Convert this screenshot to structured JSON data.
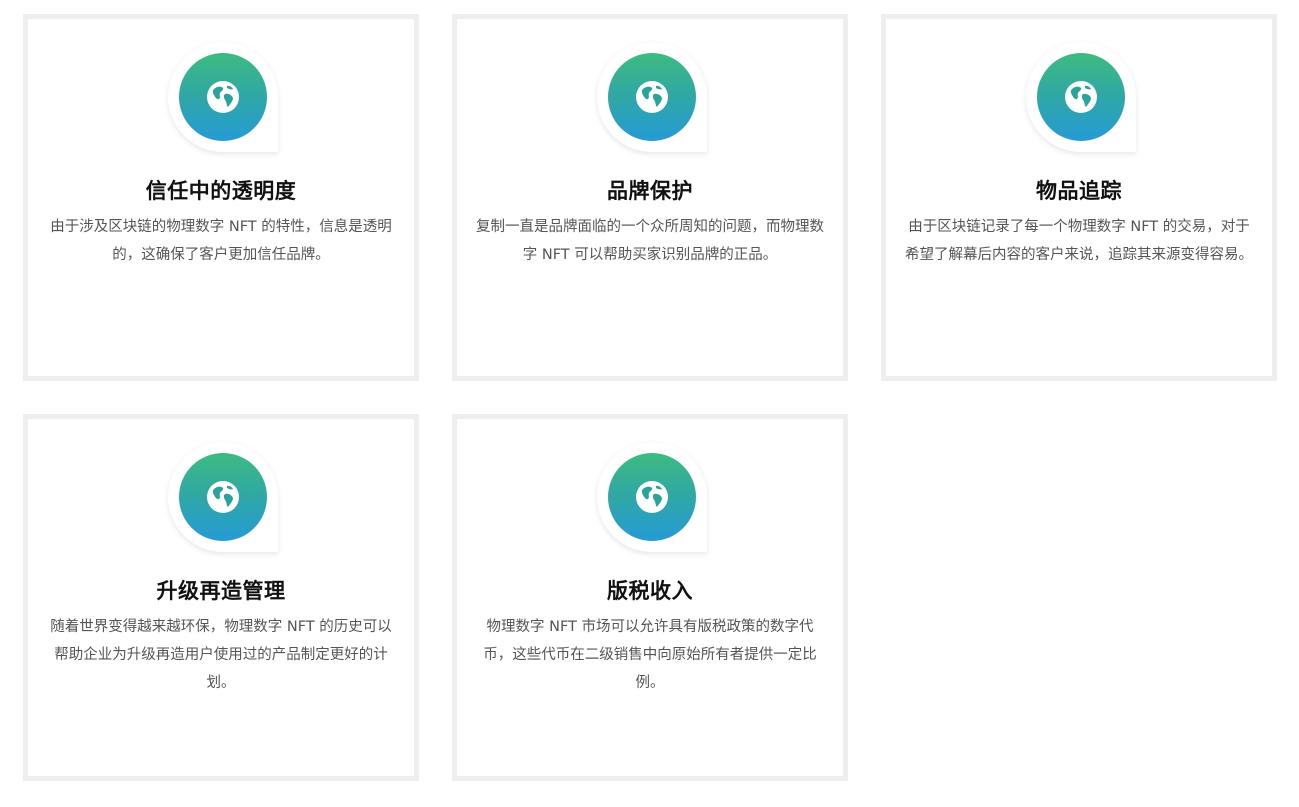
{
  "cards": [
    {
      "icon": "globe-icon",
      "title": "信任中的透明度",
      "description": "由于涉及区块链的物理数字 NFT 的特性，信息是透明的，这确保了客户更加信任品牌。"
    },
    {
      "icon": "globe-icon",
      "title": "品牌保护",
      "description": "复制一直是品牌面临的一个众所周知的问题，而物理数字 NFT 可以帮助买家识别品牌的正品。"
    },
    {
      "icon": "globe-icon",
      "title": "物品追踪",
      "description": "由于区块链记录了每一个物理数字 NFT 的交易，对于希望了解幕后内容的客户来说，追踪其来源变得容易。"
    },
    {
      "icon": "globe-icon",
      "title": "升级再造管理",
      "description": "随着世界变得越来越环保，物理数字 NFT 的历史可以帮助企业为升级再造用户使用过的产品制定更好的计划。"
    },
    {
      "icon": "globe-icon",
      "title": "版税收入",
      "description": "物理数字 NFT 市场可以允许具有版税政策的数字代币，这些代币在二级销售中向原始所有者提供一定比例。"
    }
  ],
  "colors": {
    "border": "#eeeeee",
    "gradient_top": "#3dbb80",
    "gradient_bottom": "#259bd6",
    "title": "#111111",
    "text": "#555555"
  }
}
